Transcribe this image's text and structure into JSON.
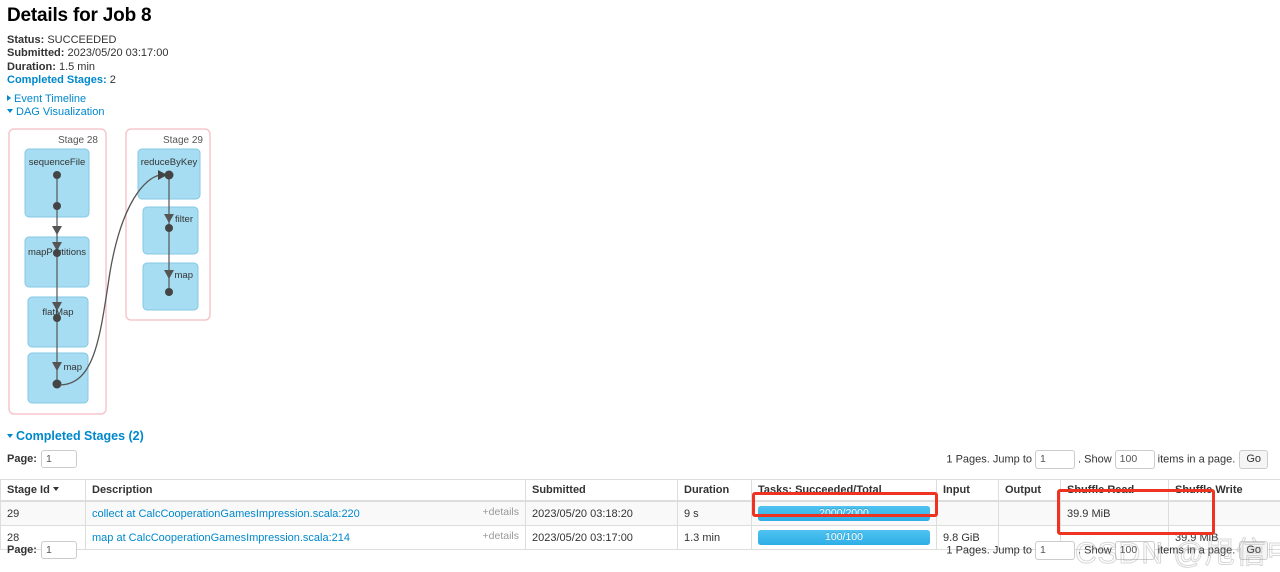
{
  "page": {
    "title": "Details for Job 8"
  },
  "summary": {
    "status_label": "Status:",
    "status_value": "SUCCEEDED",
    "submitted_label": "Submitted:",
    "submitted_value": "2023/05/20 03:17:00",
    "duration_label": "Duration:",
    "duration_value": "1.5 min",
    "completed_stages_label": "Completed Stages:",
    "completed_stages_value": "2"
  },
  "toggles": {
    "event_timeline": "Event Timeline",
    "dag_visualization": "DAG Visualization"
  },
  "dag": {
    "stages": [
      {
        "label": "Stage 28",
        "nodes": [
          "sequenceFile",
          "mapPartitions",
          "flatMap",
          "map"
        ]
      },
      {
        "label": "Stage 29",
        "nodes": [
          "reduceByKey",
          "filter",
          "map"
        ]
      }
    ],
    "colors": {
      "node_fill": "#a6ddf2",
      "node_stroke": "#86c8e4",
      "stage_border": "#f5c7cb",
      "edge": "#444444"
    }
  },
  "stages_section": {
    "header": "Completed Stages (2)",
    "page_label": "Page:",
    "page_value": "1",
    "jump": {
      "pages_text": "1 Pages. Jump to",
      "jump_value": "1",
      "show_text": ". Show",
      "show_value": "100",
      "items_text": "items in a page.",
      "go_label": "Go"
    },
    "columns": [
      "Stage Id",
      "Description",
      "Submitted",
      "Duration",
      "Tasks: Succeeded/Total",
      "Input",
      "Output",
      "Shuffle Read",
      "Shuffle Write"
    ],
    "sorted_column": "Stage Id",
    "rows": [
      {
        "stage_id": "29",
        "description": "collect at CalcCooperationGamesImpression.scala:220",
        "details": "+details",
        "submitted": "2023/05/20 03:18:20",
        "duration": "9 s",
        "tasks": "2000/2000",
        "tasks_percent": 100,
        "input": "",
        "output": "",
        "shuffle_read": "39.9 MiB",
        "shuffle_write": ""
      },
      {
        "stage_id": "28",
        "description": "map at CalcCooperationGamesImpression.scala:214",
        "details": "+details",
        "submitted": "2023/05/20 03:17:00",
        "duration": "1.3 min",
        "tasks": "100/100",
        "tasks_percent": 100,
        "input": "9.8 GiB",
        "output": "",
        "shuffle_read": "",
        "shuffle_write": "39.9 MiB"
      }
    ]
  },
  "annotations": {
    "highlight_color": "#ee3322",
    "boxes": [
      "tasks-column-highlight",
      "shuffle-columns-highlight"
    ]
  },
  "watermark": {
    "text": "CSDN @甩信中小"
  }
}
